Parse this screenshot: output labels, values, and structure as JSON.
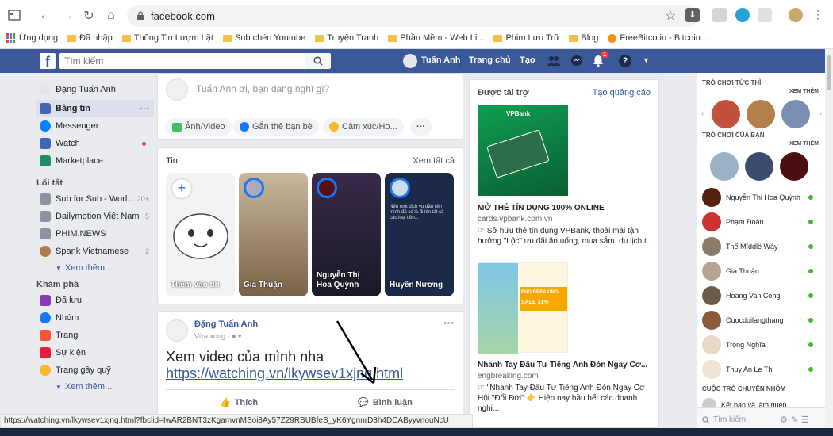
{
  "browser": {
    "url": "facebook.com",
    "bookmarks": [
      "Ứng dụng",
      "Đã nhập",
      "Thông Tin Lượm Lặt",
      "Sub chéo Youtube",
      "Truyện Tranh",
      "Phần Mềm - Web Li...",
      "Phim Lưu Trữ",
      "Blog",
      "FreeBitco.in - Bitcoin..."
    ],
    "status_url": "https://watching.vn/lkywsev1xjnq.html?fbclid=IwAR2BNT3zKgamvnMSoi8Ay57Z29RBUBfeS_yK6YgnnrD8h4DCAByyvnouNcU"
  },
  "fb": {
    "search_placeholder": "Tìm kiếm",
    "user_name": "Tuấn Anh",
    "home": "Trang chủ",
    "create": "Tạo",
    "notif_count": "1"
  },
  "leftnav": {
    "profile": "Đặng Tuấn Anh",
    "main": [
      {
        "label": "Bảng tin"
      },
      {
        "label": "Messenger"
      },
      {
        "label": "Watch"
      },
      {
        "label": "Marketplace"
      }
    ],
    "shortcuts_title": "Lối tắt",
    "shortcuts": [
      {
        "label": "Sub for Sub - Worl...",
        "count": "20+"
      },
      {
        "label": "Dailymotion Việt Nam",
        "count": "5"
      },
      {
        "label": "PHIM.NEWS",
        "count": ""
      },
      {
        "label": "Spank Vietnamese",
        "count": "2"
      }
    ],
    "see_more": "Xem thêm...",
    "explore_title": "Khám phá",
    "explore": [
      {
        "label": "Đã lưu"
      },
      {
        "label": "Nhóm"
      },
      {
        "label": "Trang"
      },
      {
        "label": "Sự kiện"
      },
      {
        "label": "Trang gây quỹ"
      }
    ]
  },
  "composer": {
    "placeholder": "Tuấn Anh ơi, bạn đang nghĩ gì?",
    "photo": "Ảnh/Video",
    "tag": "Gắn thẻ bạn bè",
    "feeling": "Cảm xúc/Ho..."
  },
  "stories": {
    "title": "Tin",
    "see_all": "Xem tất cả",
    "items": [
      {
        "name": "Thêm vào tin"
      },
      {
        "name": "Gia Thuận"
      },
      {
        "name": "Nguyễn Thị\nHoa Quỳnh"
      },
      {
        "name": "Huyền Nương"
      }
    ],
    "story4_text": "Nếu một dịch vụ dầu tiên mình đã có là đi lên tất cả các loại tiền..."
  },
  "post": {
    "author": "Đặng Tuấn Anh",
    "time": "Vừa xong",
    "text": "Xem video của mình nha",
    "link": "https://watching.vn/lkywsev1xjnq.html",
    "like": "Thích",
    "comment": "Bình luận"
  },
  "ads": {
    "title": "Được tài trợ",
    "create": "Tạo quảng cáo",
    "ad1": {
      "brand": "VPBank",
      "headline": "MỞ THẺ TÍN DỤNG 100% ONLINE",
      "domain": "cards.vpbank.com.vn",
      "desc": "☞ Sở hữu thẻ tín dụng VPBank, thoải mái tận hưởng \"Lộc\" ưu đãi ăn uống, mua sắm, du lịch t..."
    },
    "ad2": {
      "image_title": "ENG BREAKING",
      "image_sale": "SALE 31%",
      "headline": "Nhanh Tay Đầu Tư Tiếng Anh Đón Ngay Cơ...",
      "domain": "engbreaking.com",
      "desc": "☞ \"Nhanh Tay Đầu Tư Tiếng Anh Đón Ngay Cơ Hội \"Đổi Đời\" 👉 Hiện nay hầu hết các doanh nghi..."
    }
  },
  "chat": {
    "games_title": "TRÒ CHƠI TỨC THÌ",
    "your_games_title": "TRÒ CHƠI CỦA BẠN",
    "see_more": "XEM THÊM",
    "contacts": [
      "Nguyễn Thị Hoa Quỳnh",
      "Phạm Đoàn",
      "Thế Mîddlë Wây",
      "Gia Thuận",
      "Hoang Van Cong",
      "Cuocdoilangthang",
      "Trọng Nghĩa",
      "Thuy An Le Thi"
    ],
    "groups_title": "CUỘC TRÒ CHUYỆN NHÓM",
    "group1": "Kết bạn và làm quen",
    "search_placeholder": "Tìm kiếm"
  },
  "colors": {
    "fb_blue": "#3b5998",
    "link": "#365899",
    "online": "#42b72a",
    "badge": "#fa3e3e"
  }
}
